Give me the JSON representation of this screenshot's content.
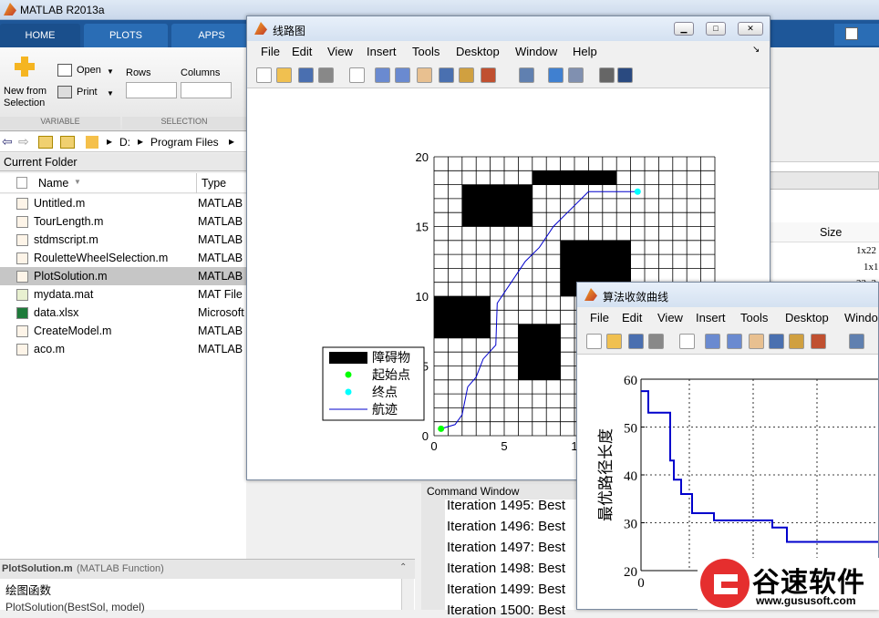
{
  "main": {
    "title": "MATLAB R2013a",
    "tabs": [
      "HOME",
      "PLOTS",
      "APPS"
    ],
    "ribbon": {
      "new_from_selection": "New from\nSelection",
      "open": "Open",
      "print": "Print",
      "rows": "Rows",
      "columns": "Columns",
      "group_variable": "VARIABLE",
      "group_selection": "SELECTION"
    },
    "address": {
      "drive": "D:",
      "sep": "▸",
      "folder": "Program Files"
    },
    "current_folder_title": "Current Folder",
    "columns": {
      "name": "Name",
      "type": "Type"
    },
    "files": [
      {
        "name": "Untitled.m",
        "type": "MATLAB",
        "icon": "m-file-icon"
      },
      {
        "name": "TourLength.m",
        "type": "MATLAB",
        "icon": "m-file-icon"
      },
      {
        "name": "stdmscript.m",
        "type": "MATLAB",
        "icon": "m-file-icon"
      },
      {
        "name": "RouletteWheelSelection.m",
        "type": "MATLAB",
        "icon": "m-file-icon"
      },
      {
        "name": "PlotSolution.m",
        "type": "MATLAB",
        "icon": "m-file-icon",
        "selected": true
      },
      {
        "name": "mydata.mat",
        "type": "MAT File",
        "icon": "mat-file-icon"
      },
      {
        "name": "data.xlsx",
        "type": "Microsoft",
        "icon": "excel-file-icon"
      },
      {
        "name": "CreateModel.m",
        "type": "MATLAB",
        "icon": "m-file-icon"
      },
      {
        "name": "aco.m",
        "type": "MATLAB",
        "icon": "m-file-icon"
      }
    ],
    "details_title": "PlotSolution.m",
    "details_kind": "(MATLAB Function)",
    "details_desc": "绘图函数",
    "details_next": "PlotSolution(BestSol, model)",
    "workspace": {
      "size_header": "Size",
      "sizes": [
        "1x22",
        "1x1",
        "22x2"
      ]
    },
    "command_window": {
      "title": "Command Window",
      "lines": [
        "Iteration 1495: Best",
        "Iteration 1496: Best",
        "Iteration 1497: Best",
        "Iteration 1498: Best",
        "Iteration 1499: Best",
        "Iteration 1500: Best"
      ]
    }
  },
  "figure1": {
    "title": "线路图",
    "menu": [
      "File",
      "Edit",
      "View",
      "Insert",
      "Tools",
      "Desktop",
      "Window",
      "Help"
    ],
    "legend": [
      "障碍物",
      "起始点",
      "终点",
      "航迹"
    ],
    "chart_data": {
      "type": "line",
      "xlim": [
        0,
        20
      ],
      "ylim": [
        0,
        20
      ],
      "xticks": [
        "0",
        "5",
        "1"
      ],
      "yticks": [
        "0",
        "5",
        "10",
        "15",
        "20"
      ],
      "grid": true,
      "obstacles": [
        {
          "x": [
            7,
            13
          ],
          "y": [
            18,
            19
          ]
        },
        {
          "x": [
            2,
            7
          ],
          "y": [
            15,
            18
          ]
        },
        {
          "x": [
            9,
            14
          ],
          "y": [
            10,
            14
          ]
        },
        {
          "x": [
            0,
            4
          ],
          "y": [
            7,
            10
          ]
        },
        {
          "x": [
            6,
            9
          ],
          "y": [
            4,
            8
          ]
        }
      ],
      "start": [
        0.5,
        0.5
      ],
      "end": [
        14.5,
        17.5
      ],
      "path": [
        [
          0.5,
          0.5
        ],
        [
          1.5,
          0.8
        ],
        [
          2,
          1.5
        ],
        [
          2.4,
          3.5
        ],
        [
          3,
          4.2
        ],
        [
          3.5,
          5.5
        ],
        [
          4.4,
          6.5
        ],
        [
          4.5,
          9.5
        ],
        [
          5.5,
          11
        ],
        [
          6.5,
          12.5
        ],
        [
          7.5,
          13.5
        ],
        [
          8.5,
          15
        ],
        [
          9.5,
          16
        ],
        [
          10,
          16.5
        ],
        [
          11,
          17.5
        ],
        [
          14.5,
          17.5
        ]
      ],
      "colors": {
        "obstacle": "#000000",
        "start": "#00ff00",
        "end": "#00ffff",
        "path": "#0000cc"
      }
    }
  },
  "figure2": {
    "title": "算法收敛曲线",
    "menu": [
      "File",
      "Edit",
      "View",
      "Insert",
      "Tools",
      "Desktop",
      "Windo"
    ],
    "chart_data": {
      "type": "line",
      "ylabel": "最优路径长度",
      "ylim": [
        20,
        60
      ],
      "yticks": [
        "20",
        "30",
        "40",
        "50",
        "60"
      ],
      "xticks": [
        "0"
      ],
      "grid": true,
      "series": [
        {
          "x": [
            0,
            1,
            1,
            4,
            4,
            4.5,
            4.5,
            5.5,
            5.5,
            7,
            7,
            10,
            10,
            18,
            18,
            20,
            20,
            50
          ],
          "y": [
            57.5,
            57.5,
            53,
            53,
            43,
            43,
            39,
            39,
            36,
            36,
            32,
            32,
            30.5,
            30.5,
            29,
            29,
            26,
            26
          ],
          "color": "#0000cc"
        }
      ],
      "xlim": [
        0,
        50
      ]
    }
  },
  "watermark": {
    "brand": "谷速软件",
    "url": "www.gususoft.com"
  }
}
